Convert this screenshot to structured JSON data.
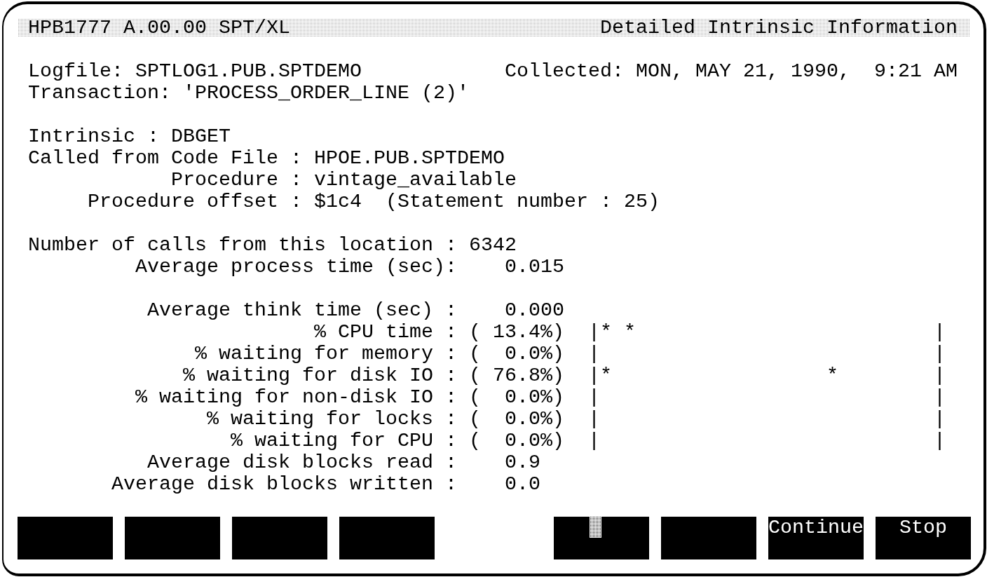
{
  "title_bar": {
    "product": "HPB1777 A.00.00 SPT/XL",
    "screen_title": "Detailed Intrinsic Information"
  },
  "logfile": {
    "label": "Logfile:",
    "value": "SPTLOG1.PUB.SPTDEMO"
  },
  "collected": {
    "label": "Collected:",
    "value": "MON, MAY 21, 1990,  9:21 AM"
  },
  "transaction": {
    "label": "Transaction:",
    "value": "'PROCESS_ORDER_LINE (2)'"
  },
  "intrinsic": {
    "label": "Intrinsic :",
    "value": "DBGET"
  },
  "location": [
    {
      "label": "Called from Code File :",
      "value": "HPOE.PUB.SPTDEMO"
    },
    {
      "label": "Procedure :",
      "value": "vintage_available"
    },
    {
      "label": "Procedure offset :",
      "value": "$1c4",
      "note": "(Statement number : 25)"
    }
  ],
  "call_statistics": [
    {
      "kind": "count",
      "label": "Number of calls from this location :",
      "value": "6342"
    },
    {
      "kind": "average",
      "label": "Average process time (sec):",
      "value": "0.015"
    }
  ],
  "time_breakdown": [
    {
      "kind": "average",
      "label": "Average think time (sec) :",
      "value": "0.000"
    },
    {
      "kind": "percent",
      "label": "% CPU time :",
      "value": "( 13.4%)",
      "bar": "|* *                         |"
    },
    {
      "kind": "percent",
      "label": "% waiting for memory :",
      "value": "(  0.0%)",
      "bar": "|                            |"
    },
    {
      "kind": "percent",
      "label": "% waiting for disk IO :",
      "value": "( 76.8%)",
      "bar": "|*                  *        |"
    },
    {
      "kind": "percent",
      "label": "% waiting for non-disk IO :",
      "value": "(  0.0%)",
      "bar": "|                            |"
    },
    {
      "kind": "percent",
      "label": "% waiting for locks :",
      "value": "(  0.0%)",
      "bar": "|                            |"
    },
    {
      "kind": "percent",
      "label": "% waiting for CPU :",
      "value": "(  0.0%)",
      "bar": "|                            |"
    },
    {
      "kind": "average",
      "label": "Average disk blocks read :",
      "value": "0.9"
    },
    {
      "kind": "average",
      "label": "Average disk blocks written :",
      "value": "0.0"
    }
  ],
  "function_keys": [
    {
      "cursor": false
    },
    {
      "cursor": false
    },
    {
      "cursor": false
    },
    {
      "cursor": false
    },
    {
      "cursor": true
    },
    {
      "cursor": false
    },
    {
      "label": "Continue",
      "cursor": false
    },
    {
      "label": "Stop",
      "cursor": false
    }
  ]
}
